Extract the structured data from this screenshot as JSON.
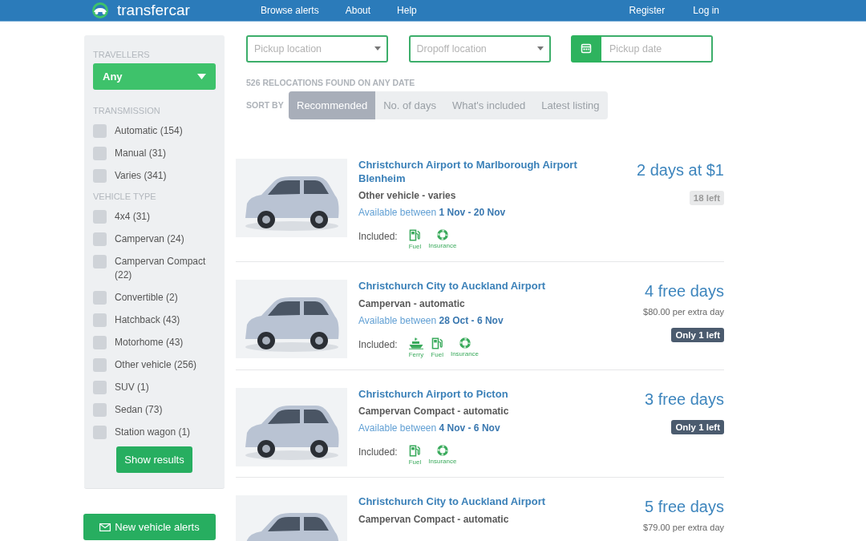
{
  "navbar": {
    "logo": "transfercar",
    "links": [
      {
        "label": "Browse alerts"
      },
      {
        "label": "About"
      },
      {
        "label": "Help"
      }
    ],
    "account_links": [
      {
        "label": "Register"
      },
      {
        "label": "Log in"
      }
    ]
  },
  "filters": {
    "sections": [
      {
        "kind": "dropdown",
        "title": "TRAVELLERS",
        "value": "Any"
      },
      {
        "kind": "checkboxes",
        "title": "TRANSMISSION",
        "options": [
          {
            "label": "Automatic (154)",
            "checked": false
          },
          {
            "label": "Manual (31)",
            "checked": false
          },
          {
            "label": "Varies (341)",
            "checked": false
          }
        ]
      },
      {
        "kind": "checkboxes",
        "title": "VEHICLE TYPE",
        "options": [
          {
            "label": "4x4 (31)",
            "checked": false
          },
          {
            "label": "Campervan (24)",
            "checked": false
          },
          {
            "label": "Campervan Compact (22)",
            "checked": false
          },
          {
            "label": "Convertible (2)",
            "checked": false
          },
          {
            "label": "Hatchback (43)",
            "checked": false
          },
          {
            "label": "Motorhome (43)",
            "checked": false
          },
          {
            "label": "Other vehicle (256)",
            "checked": false
          },
          {
            "label": "SUV (1)",
            "checked": false
          },
          {
            "label": "Sedan (73)",
            "checked": false
          },
          {
            "label": "Station wagon (1)",
            "checked": false
          }
        ]
      }
    ],
    "submit_button": "Show results"
  },
  "alerts_button": "New vehicle alerts",
  "search_fields": [
    {
      "kind": "select",
      "placeholder": "Pickup location"
    },
    {
      "kind": "select",
      "placeholder": "Dropoff location"
    },
    {
      "kind": "date",
      "placeholder": "Pickup date"
    }
  ],
  "results_count": "526 RELOCATIONS FOUND ON ANY DATE",
  "sort": {
    "label": "SORT BY",
    "options": [
      {
        "label": "Recommended",
        "selected": true
      },
      {
        "label": "No. of days",
        "selected": false
      },
      {
        "label": "What's included",
        "selected": false
      },
      {
        "label": "Latest listing",
        "selected": false
      }
    ]
  },
  "listings": [
    {
      "title": "Christchurch Airport to Marlborough Airport Blenheim",
      "vehicle": "Other vehicle - varies",
      "availability": "Available between **1 Nov - 20 Nov**",
      "included_label": "Included:",
      "included": [
        {
          "kind": "fuel",
          "label": "Fuel"
        },
        {
          "kind": "insurance",
          "label": "Insurance"
        }
      ],
      "price": "2 days at $1",
      "badge": {
        "text": "18 left",
        "urgent": false
      }
    },
    {
      "title": "Christchurch City to Auckland Airport",
      "vehicle": "Campervan - automatic",
      "availability": "Available between **28 Oct - 6 Nov**",
      "included_label": "Included:",
      "included": [
        {
          "kind": "ferry",
          "label": "Ferry"
        },
        {
          "kind": "fuel",
          "label": "Fuel"
        },
        {
          "kind": "insurance",
          "label": "Insurance"
        }
      ],
      "price": "4 free days",
      "extra_day": "$80.00 per extra day",
      "badge": {
        "text": "Only 1 left",
        "urgent": true
      }
    },
    {
      "title": "Christchurch Airport to Picton",
      "vehicle": "Campervan Compact - automatic",
      "availability": "Available between **4 Nov - 6 Nov**",
      "included_label": "Included:",
      "included": [
        {
          "kind": "fuel",
          "label": "Fuel"
        },
        {
          "kind": "insurance",
          "label": "Insurance"
        }
      ],
      "price": "3 free days",
      "badge": {
        "text": "Only 1 left",
        "urgent": true
      }
    },
    {
      "title": "Christchurch City to Auckland Airport",
      "vehicle": "Campervan Compact - automatic",
      "price": "5 free days",
      "extra_day": "$79.00 per extra day"
    }
  ]
}
